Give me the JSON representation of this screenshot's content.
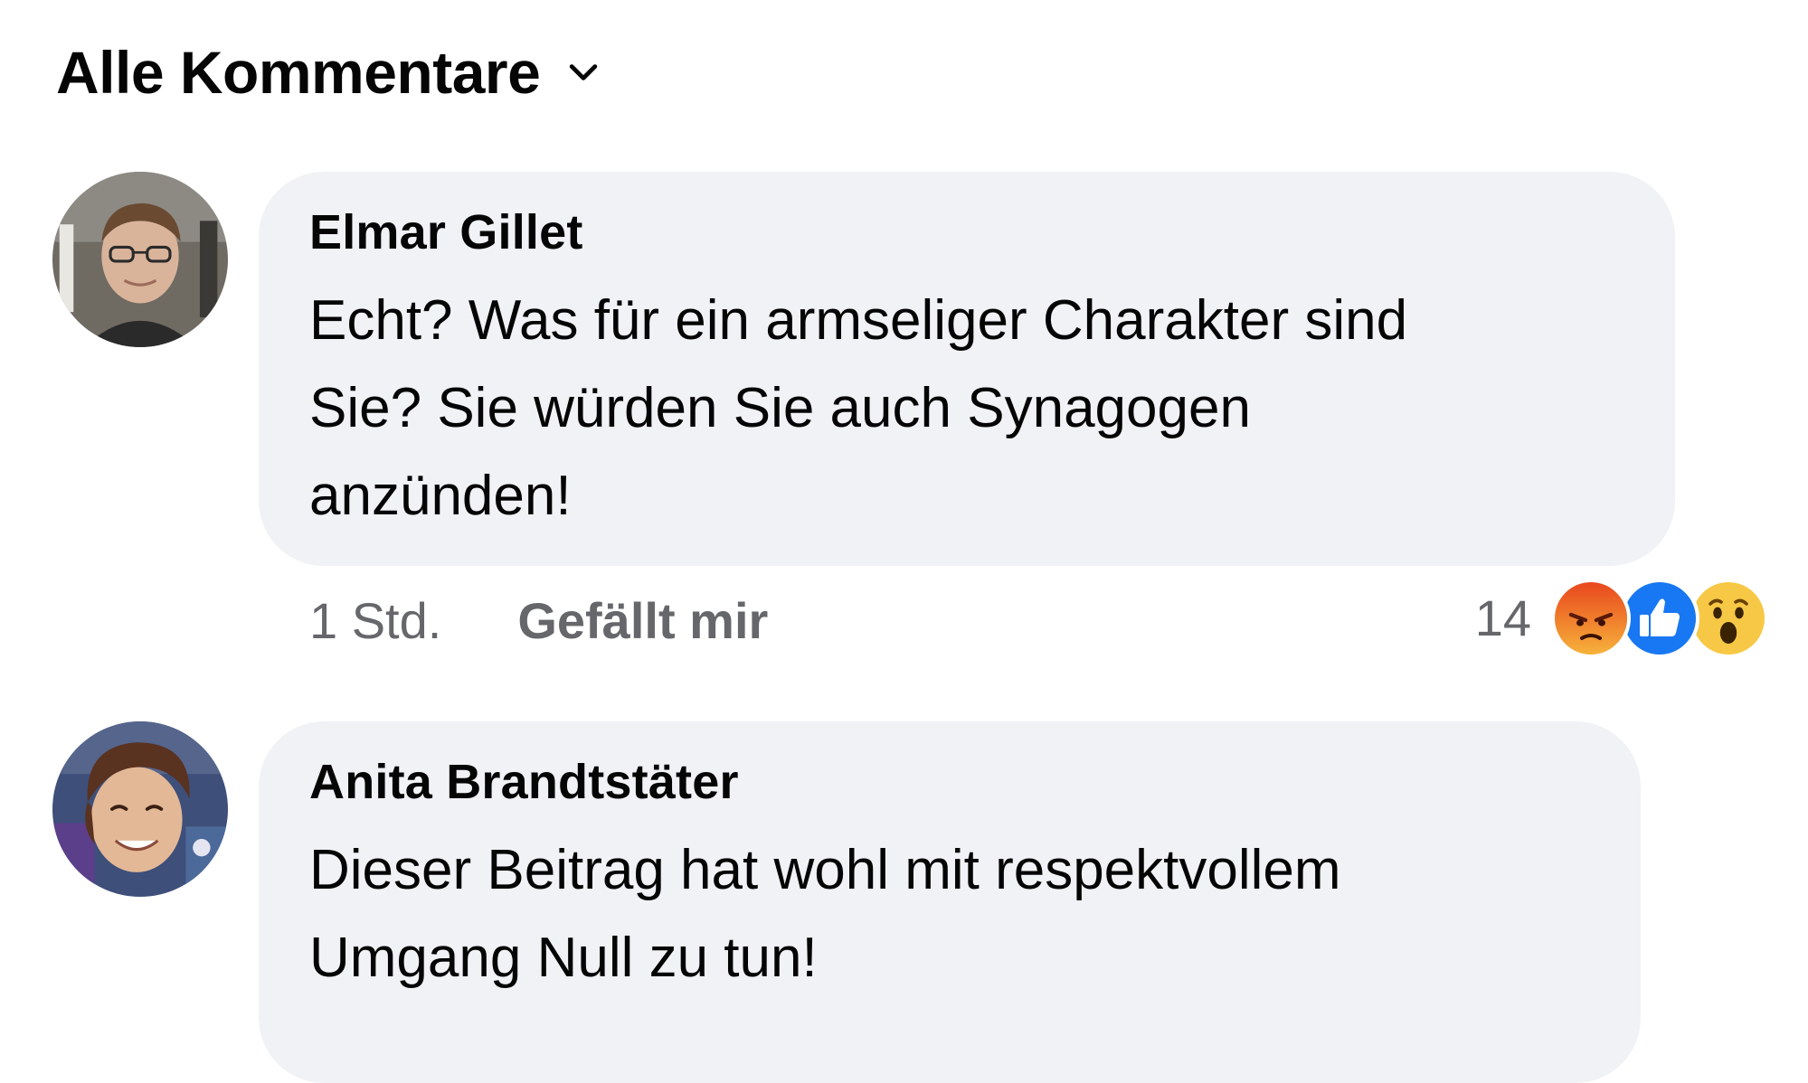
{
  "filter": {
    "label": "Alle Kommentare",
    "icon": "chevron-down-icon"
  },
  "comments": [
    {
      "author": "Elmar Gillet",
      "text_lines": [
        "Echt? Was für ein armseliger Charakter sind",
        "Sie? Sie würden Sie auch Synagogen",
        "anzünden!"
      ],
      "time": "1 Std.",
      "like_label": "Gefällt mir",
      "reaction_count": "14",
      "reactions": [
        "angry-reaction-icon",
        "like-reaction-icon",
        "wow-reaction-icon"
      ]
    },
    {
      "author": "Anita Brandtstäter",
      "text_lines": [
        "Dieser Beitrag hat wohl mit respektvollem",
        "Umgang Null zu tun!"
      ]
    }
  ],
  "colors": {
    "bubble_bg": "#f0f2f5",
    "secondary_text": "#65676b",
    "primary_text": "#050505",
    "like_blue": "#1877f2"
  }
}
